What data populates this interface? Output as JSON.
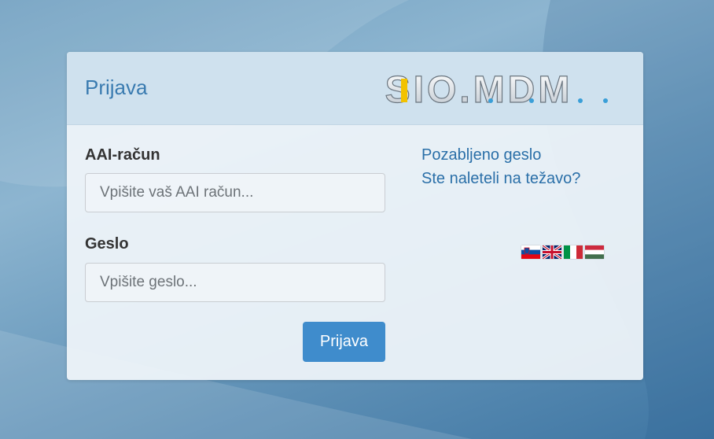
{
  "header": {
    "title": "Prijava",
    "logo_text": "SIO.MDM"
  },
  "form": {
    "account_label": "AAI-račun",
    "account_placeholder": "Vpišite vaš AAI račun...",
    "account_value": "",
    "password_label": "Geslo",
    "password_placeholder": "Vpišite geslo...",
    "password_value": "",
    "submit_label": "Prijava"
  },
  "links": {
    "forgot_password": "Pozabljeno geslo",
    "problem": "Ste naleteli na težavo?"
  },
  "languages": [
    {
      "name": "slovenian-flag-icon"
    },
    {
      "name": "uk-flag-icon"
    },
    {
      "name": "italian-flag-icon"
    },
    {
      "name": "hungarian-flag-icon"
    }
  ],
  "colors": {
    "accent": "#3f8ccc",
    "title": "#3a7bb0",
    "link": "#2a6fa8",
    "header_bg": "#cfe1ee"
  }
}
